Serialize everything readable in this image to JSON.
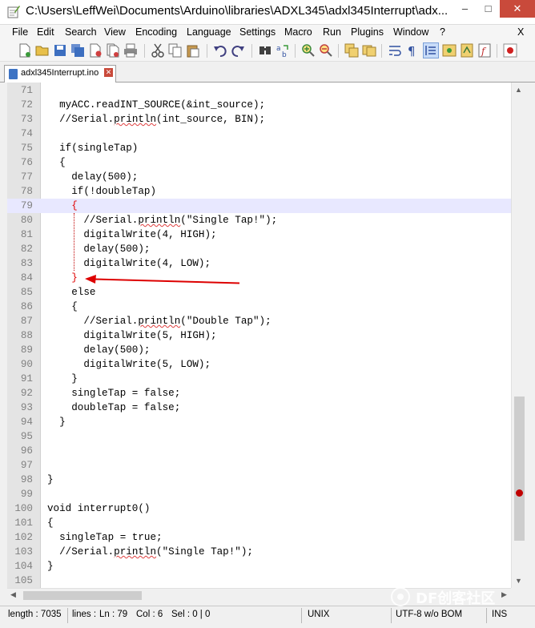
{
  "window": {
    "title": "C:\\Users\\LeffWei\\Documents\\Arduino\\libraries\\ADXL345\\adxl345Interrupt\\adx...",
    "minimize": "–",
    "maximize": "□",
    "close": "✕"
  },
  "menu": {
    "items": [
      "File",
      "Edit",
      "Search",
      "View",
      "Encoding",
      "Language",
      "Settings",
      "Macro",
      "Run",
      "Plugins",
      "Window",
      "?"
    ],
    "close_doc": "X"
  },
  "tab": {
    "label": "adxl345Interrupt.ino",
    "close": "✕"
  },
  "editor": {
    "current_line": 79,
    "lines": [
      {
        "n": "71",
        "text": ""
      },
      {
        "n": "72",
        "text": "  myACC.readINT_SOURCE(&int_source);"
      },
      {
        "n": "73",
        "text": "  //Serial.println(int_source, BIN);"
      },
      {
        "n": "74",
        "text": ""
      },
      {
        "n": "75",
        "text": "  if(singleTap)"
      },
      {
        "n": "76",
        "text": "  {"
      },
      {
        "n": "77",
        "text": "    delay(500);"
      },
      {
        "n": "78",
        "text": "    if(!doubleTap)"
      },
      {
        "n": "79",
        "text": "    {"
      },
      {
        "n": "80",
        "text": "      //Serial.println(\"Single Tap!\");"
      },
      {
        "n": "81",
        "text": "      digitalWrite(4, HIGH);"
      },
      {
        "n": "82",
        "text": "      delay(500);"
      },
      {
        "n": "83",
        "text": "      digitalWrite(4, LOW);"
      },
      {
        "n": "84",
        "text": "    }"
      },
      {
        "n": "85",
        "text": "    else"
      },
      {
        "n": "86",
        "text": "    {"
      },
      {
        "n": "87",
        "text": "      //Serial.println(\"Double Tap\");"
      },
      {
        "n": "88",
        "text": "      digitalWrite(5, HIGH);"
      },
      {
        "n": "89",
        "text": "      delay(500);"
      },
      {
        "n": "90",
        "text": "      digitalWrite(5, LOW);"
      },
      {
        "n": "91",
        "text": "    }"
      },
      {
        "n": "92",
        "text": "    singleTap = false;"
      },
      {
        "n": "93",
        "text": "    doubleTap = false;"
      },
      {
        "n": "94",
        "text": "  }"
      },
      {
        "n": "95",
        "text": ""
      },
      {
        "n": "96",
        "text": ""
      },
      {
        "n": "97",
        "text": ""
      },
      {
        "n": "98",
        "text": "}"
      },
      {
        "n": "99",
        "text": ""
      },
      {
        "n": "100",
        "text": "void interrupt0()"
      },
      {
        "n": "101",
        "text": "{"
      },
      {
        "n": "102",
        "text": "  singleTap = true;"
      },
      {
        "n": "103",
        "text": "  //Serial.println(\"Single Tap!\");"
      },
      {
        "n": "104",
        "text": "}"
      },
      {
        "n": "105",
        "text": ""
      }
    ]
  },
  "status": {
    "length": "length : 7035",
    "lines": "lines :",
    "ln": "Ln : 79",
    "col": "Col : 6",
    "sel": "Sel : 0 | 0",
    "eol": "UNIX",
    "encoding": "UTF-8 w/o BOM",
    "mode": "INS"
  },
  "watermark": "DF创客社区",
  "colors": {
    "current_line": "#e8e8ff",
    "brace_match": "#e00000",
    "arrow": "#dd0000",
    "gutter": "#e4e4e4"
  }
}
